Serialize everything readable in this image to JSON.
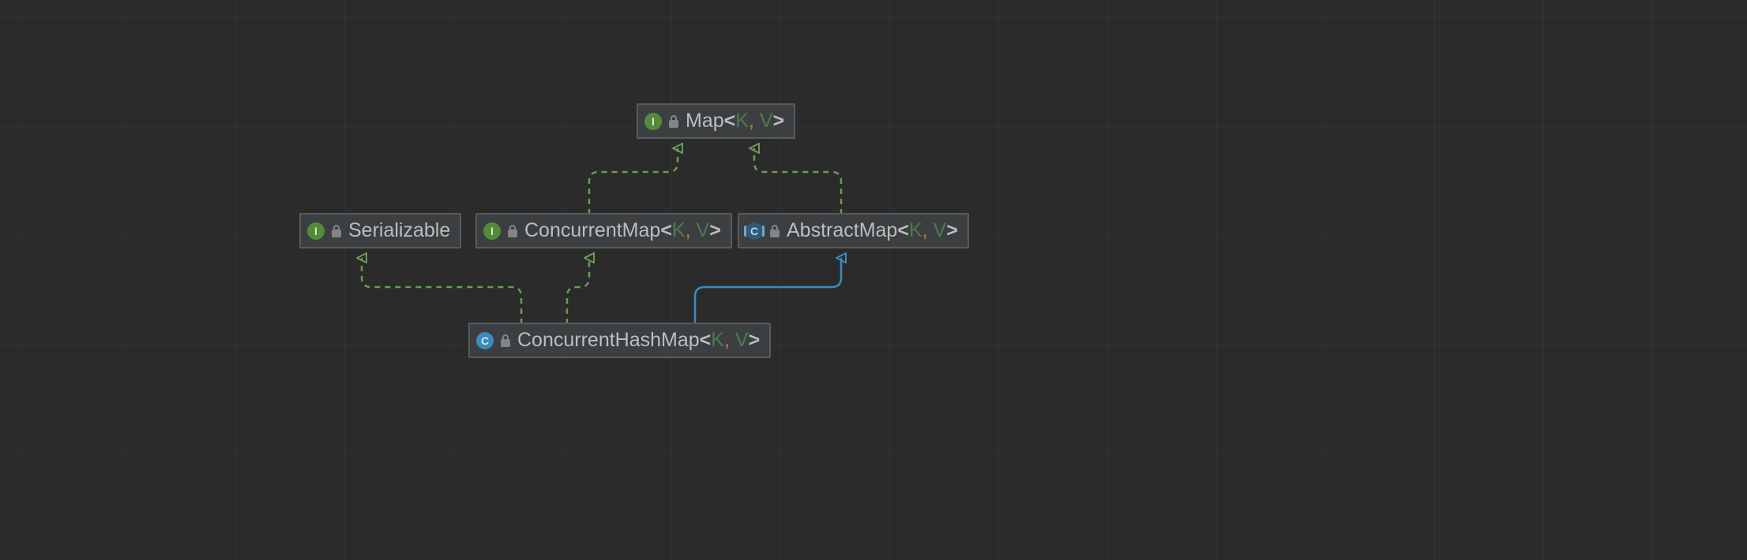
{
  "colors": {
    "canvas_bg": "#2b2b2b",
    "grid_line": "rgba(255,255,255,0.035)",
    "node_bg": "#3c3f41",
    "node_border": "#585a5c",
    "text": "#bdbdbd",
    "typeparam": "#4e7a4e",
    "comma": "#cc7832",
    "interface_badge": "#548a3c",
    "class_badge": "#3d8bbd",
    "arrow_green": "#6a9b56",
    "arrow_blue": "#3d8bbd"
  },
  "nodes": {
    "map": {
      "kind": "interface",
      "badge_letter": "I",
      "name": "Map",
      "generics": [
        "K",
        "V"
      ],
      "lock": true
    },
    "serializable": {
      "kind": "interface",
      "badge_letter": "I",
      "name": "Serializable",
      "generics": [],
      "lock": true
    },
    "concurrentmap": {
      "kind": "interface",
      "badge_letter": "I",
      "name": "ConcurrentMap",
      "generics": [
        "K",
        "V"
      ],
      "lock": true
    },
    "abstractmap": {
      "kind": "abstract",
      "badge_letter": "C",
      "name": "AbstractMap",
      "generics": [
        "K",
        "V"
      ],
      "lock": true
    },
    "concurrenthashmap": {
      "kind": "class",
      "badge_letter": "C",
      "name": "ConcurrentHashMap",
      "generics": [
        "K",
        "V"
      ],
      "lock": true
    }
  },
  "edges": [
    {
      "from": "concurrentmap",
      "to": "map",
      "style": "implements"
    },
    {
      "from": "abstractmap",
      "to": "map",
      "style": "implements"
    },
    {
      "from": "concurrenthashmap",
      "to": "serializable",
      "style": "implements"
    },
    {
      "from": "concurrenthashmap",
      "to": "concurrentmap",
      "style": "implements"
    },
    {
      "from": "concurrenthashmap",
      "to": "abstractmap",
      "style": "extends"
    }
  ]
}
